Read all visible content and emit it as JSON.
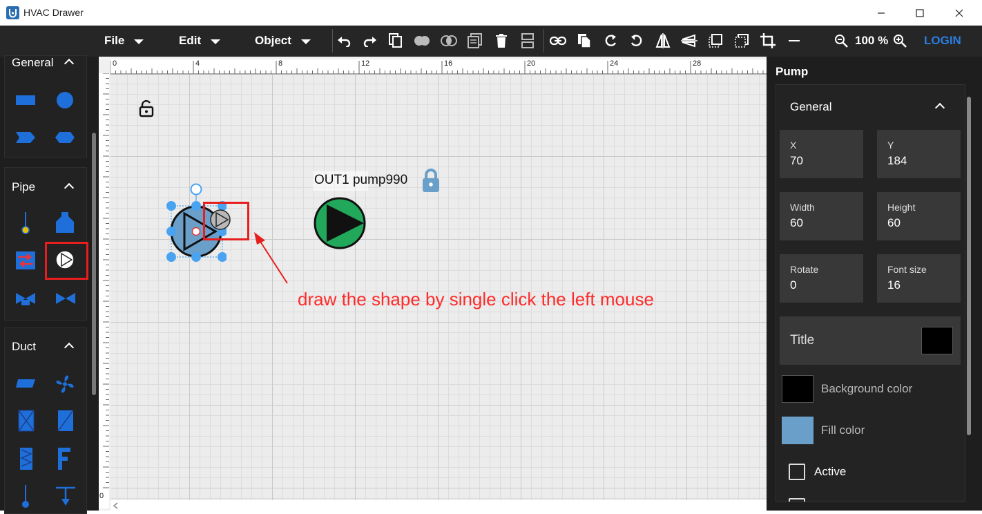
{
  "window": {
    "title": "HVAC Drawer",
    "icon": "app-logo-icon",
    "minimize": "—",
    "maximize": "☐",
    "close": "✕"
  },
  "menubar": {
    "menus": [
      "File",
      "Edit",
      "Object"
    ],
    "toolbar_icons": [
      "undo-icon",
      "redo-icon",
      "copy-icon",
      "union-icon",
      "intersect-icon",
      "paste-icon",
      "delete-icon",
      "align-icon",
      "link-icon",
      "duplicate-icon",
      "rotate-left-icon",
      "rotate-right-icon",
      "flip-horizontal-icon",
      "flip-vertical-icon",
      "bring-front-icon",
      "send-back-icon",
      "crop-icon",
      "minus-icon",
      "zoom-out-icon",
      "zoom-in-icon"
    ],
    "zoom": "100 %",
    "login": "LOGIN"
  },
  "sidebar": {
    "sections": [
      {
        "title": "General",
        "shapes": [
          "rectangle",
          "circle",
          "chevron",
          "hexagon"
        ]
      },
      {
        "title": "Pipe",
        "shapes": [
          "thermometer",
          "tank",
          "heat-exchanger",
          "pump",
          "valve-actuated",
          "valve"
        ]
      },
      {
        "title": "Duct",
        "shapes": [
          "duct",
          "fan",
          "damper",
          "filter",
          "coil",
          "f-fitting",
          "sensor",
          "tee"
        ]
      }
    ],
    "accent": "#1e6fd9"
  },
  "ruler": {
    "ticks": [
      "0",
      "4",
      "8",
      "12",
      "16",
      "20",
      "24",
      "28"
    ],
    "v_bottom": "0"
  },
  "canvas": {
    "placed_label": "OUT1 pump990",
    "annotation": "draw the shape by single click the left mouse",
    "annotation_color": "#ff2a2a",
    "pump_fill": "#6a9fc9",
    "placed_pump_fill": "#22a85a"
  },
  "props": {
    "title": "Pump",
    "section": "General",
    "fields": [
      {
        "label": "X",
        "value": "70"
      },
      {
        "label": "Y",
        "value": "184"
      },
      {
        "label": "Width",
        "value": "60"
      },
      {
        "label": "Height",
        "value": "60"
      },
      {
        "label": "Rotate",
        "value": "0"
      },
      {
        "label": "Font size",
        "value": "16"
      }
    ],
    "title_field": "Title",
    "background_label": "Background color",
    "background_color": "#000000",
    "fill_label": "Fill color",
    "fill_color": "#6a9fc9",
    "active_label": "Active"
  }
}
